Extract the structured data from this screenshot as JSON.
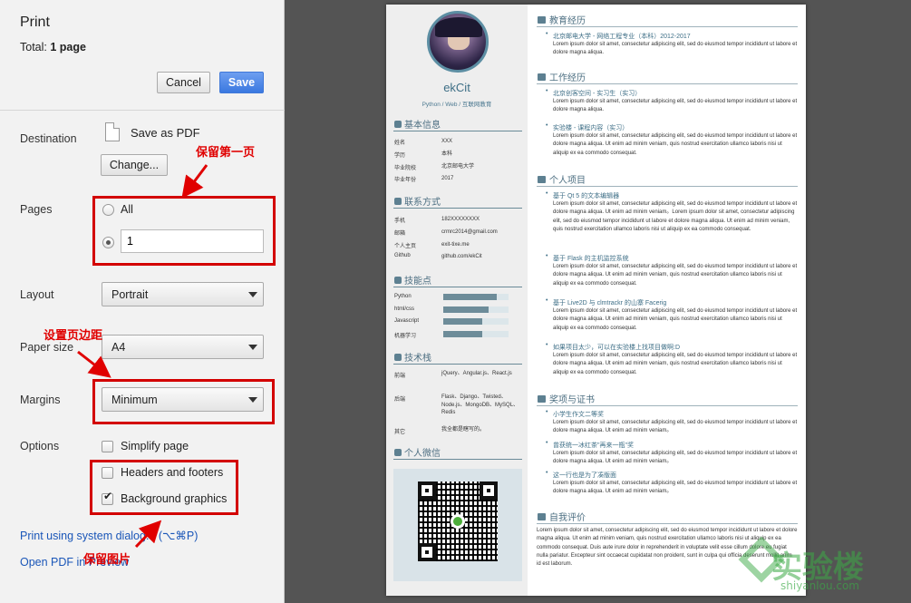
{
  "dialog": {
    "title": "Print",
    "total_label": "Total:",
    "total_value": "1 page",
    "cancel_label": "Cancel",
    "save_label": "Save",
    "destination_label": "Destination",
    "destination_value": "Save as PDF",
    "change_label": "Change...",
    "pages_label": "Pages",
    "pages_all_label": "All",
    "pages_range_value": "1",
    "layout_label": "Layout",
    "layout_value": "Portrait",
    "paper_size_label": "Paper size",
    "paper_size_value": "A4",
    "margins_label": "Margins",
    "margins_value": "Minimum",
    "options_label": "Options",
    "options": [
      {
        "label": "Simplify page",
        "checked": false
      },
      {
        "label": "Headers and footers",
        "checked": false
      },
      {
        "label": "Background graphics",
        "checked": true
      }
    ],
    "system_dialog_link": "Print using system dialog... (⌥⌘P)",
    "open_pdf_link": "Open PDF in Preview"
  },
  "annotations": {
    "keep_first_page": "保留第一页",
    "set_margins": "设置页边距",
    "keep_images": "保留图片"
  },
  "resume": {
    "name": "ekCit",
    "subtitle": "Python / Web / 互联网教育",
    "basic_title": "基本信息",
    "basic": [
      {
        "k": "姓名",
        "v": "XXX"
      },
      {
        "k": "学历",
        "v": "本科"
      },
      {
        "k": "毕业院校",
        "v": "北京邮电大学"
      },
      {
        "k": "毕业年份",
        "v": "2017"
      }
    ],
    "contact_title": "联系方式",
    "contact": [
      {
        "k": "手机",
        "v": "182XXXXXXXX"
      },
      {
        "k": "邮箱",
        "v": "crmrc2014@gmail.com"
      },
      {
        "k": "个人主页",
        "v": "exit-tixe.me"
      },
      {
        "k": "Github",
        "v": "github.com/ekCit"
      }
    ],
    "skills_title": "技能点",
    "skills": [
      {
        "name": "Python",
        "level": 0.82
      },
      {
        "name": "html/css",
        "level": 0.7
      },
      {
        "name": "Javascript",
        "level": 0.6
      },
      {
        "name": "机器学习",
        "level": 0.6
      }
    ],
    "stack_title": "技术栈",
    "stack": [
      {
        "k": "前端",
        "v": "jQuery、Angular.js、React.js"
      },
      {
        "k": "后端",
        "v": "Flask、Django、Twisted、Node.js、MongoDB、MySQL、Redis"
      },
      {
        "k": "其它",
        "v": "我全都是瞎写的。"
      }
    ],
    "wechat_title": "个人微信",
    "education_title": "教育经历",
    "education_item": "北京邮电大学 - 网络工程专业（本科）2012-2017",
    "education_text": "Lorem ipsum dolor sit amet, consectetur adipiscing elit, sed do eiusmod tempor incididunt ut labore et dolore magna aliqua.",
    "work_title": "工作经历",
    "work_item1": "北京创客空间 - 实习生（实习）",
    "work_text1": "Lorem ipsum dolor sit amet, consectetur adipiscing elit, sed do eiusmod tempor incididunt ut labore et dolore magna aliqua.",
    "work_item2": "实验楼 - 课程内容（实习）",
    "work_text2": "Lorem ipsum dolor sit amet, consectetur adipiscing elit, sed do eiusmod tempor incididunt ut labore et dolore magna aliqua. Ut enim ad minim veniam, quis nostrud exercitation ullamco laboris nisi ut aliquip ex ea commodo consequat.",
    "projects_title": "个人项目",
    "project1": "基于 Qt 5 的文本编辑器",
    "project1_text": "Lorem ipsum dolor sit amet, consectetur adipiscing elit, sed do eiusmod tempor incididunt ut labore et dolore magna aliqua. Ut enim ad minim veniam。Lorem ipsum dolor sit amet, consectetur adipiscing elit, sed do eiusmod tempor incididunt ut labore et dolore magna aliqua. Ut enim ad minim veniam, quis nostrud exercitation ullamco laboris nisi ut aliquip ex ea commodo consequat.",
    "project2": "基于 Flask 的主机监控系统",
    "project2_text": "Lorem ipsum dolor sit amet, consectetur adipiscing elit, sed do eiusmod tempor incididunt ut labore et dolore magna aliqua. Ut enim ad minim veniam, quis nostrud exercitation ullamco laboris nisi ut aliquip ex ea commodo consequat.",
    "project3": "基于 Live2D 与 clmtrackr 的山寨 Facerig",
    "project3_text": "Lorem ipsum dolor sit amet, consectetur adipiscing elit, sed do eiusmod tempor incididunt ut labore et dolore magna aliqua. Ut enim ad minim veniam, quis nostrud exercitation ullamco laboris nisi ut aliquip ex ea commodo consequat.",
    "project4": "如果项目太少，可以在实验楼上找项目做啊:D",
    "project4_text": "Lorem ipsum dolor sit amet, consectetur adipiscing elit, sed do eiusmod tempor incididunt ut labore et dolore magna aliqua. Ut enim ad minim veniam, quis nostrud exercitation ullamco laboris nisi ut aliquip ex ea commodo consequat.",
    "awards_title": "奖项与证书",
    "award1": "小学生作文二等奖",
    "award1_text": "Lorem ipsum dolor sit amet, consectetur adipiscing elit, sed do eiusmod tempor incididunt ut labore et dolore magna aliqua. Ut enim ad minim veniam。",
    "award2": "曾获统一冰红茶\"再来一瓶\"奖",
    "award2_text": "Lorem ipsum dolor sit amet, consectetur adipiscing elit, sed do eiusmod tempor incididunt ut labore et dolore magna aliqua. Ut enim ad minim veniam。",
    "award3": "这一行也是为了凑版面",
    "award3_text": "Lorem ipsum dolor sit amet, consectetur adipiscing elit, sed do eiusmod tempor incididunt ut labore et dolore magna aliqua. Ut enim ad minim veniam。",
    "self_title": "自我评价",
    "self_text": "Lorem ipsum dolor sit amet, consectetur adipiscing elit, sed do eiusmod tempor incididunt ut labore et dolore magna aliqua. Ut enim ad minim veniam, quis nostrud exercitation ullamco laboris nisi ut aliquip ex ea commodo consequat. Duis aute irure dolor in reprehenderit in voluptate velit esse cillum dolore eu fugiat nulla pariatur. Excepteur sint occaecat cupidatat non proident, sunt in culpa qui officia deserunt mollit anim id est laborum."
  },
  "watermark": {
    "brand": "实验楼",
    "url": "shiyanlou.com"
  },
  "colors": {
    "save_button": "#3a78e0",
    "annotation_red": "#d30000",
    "resume_accent": "#4d6f82"
  }
}
